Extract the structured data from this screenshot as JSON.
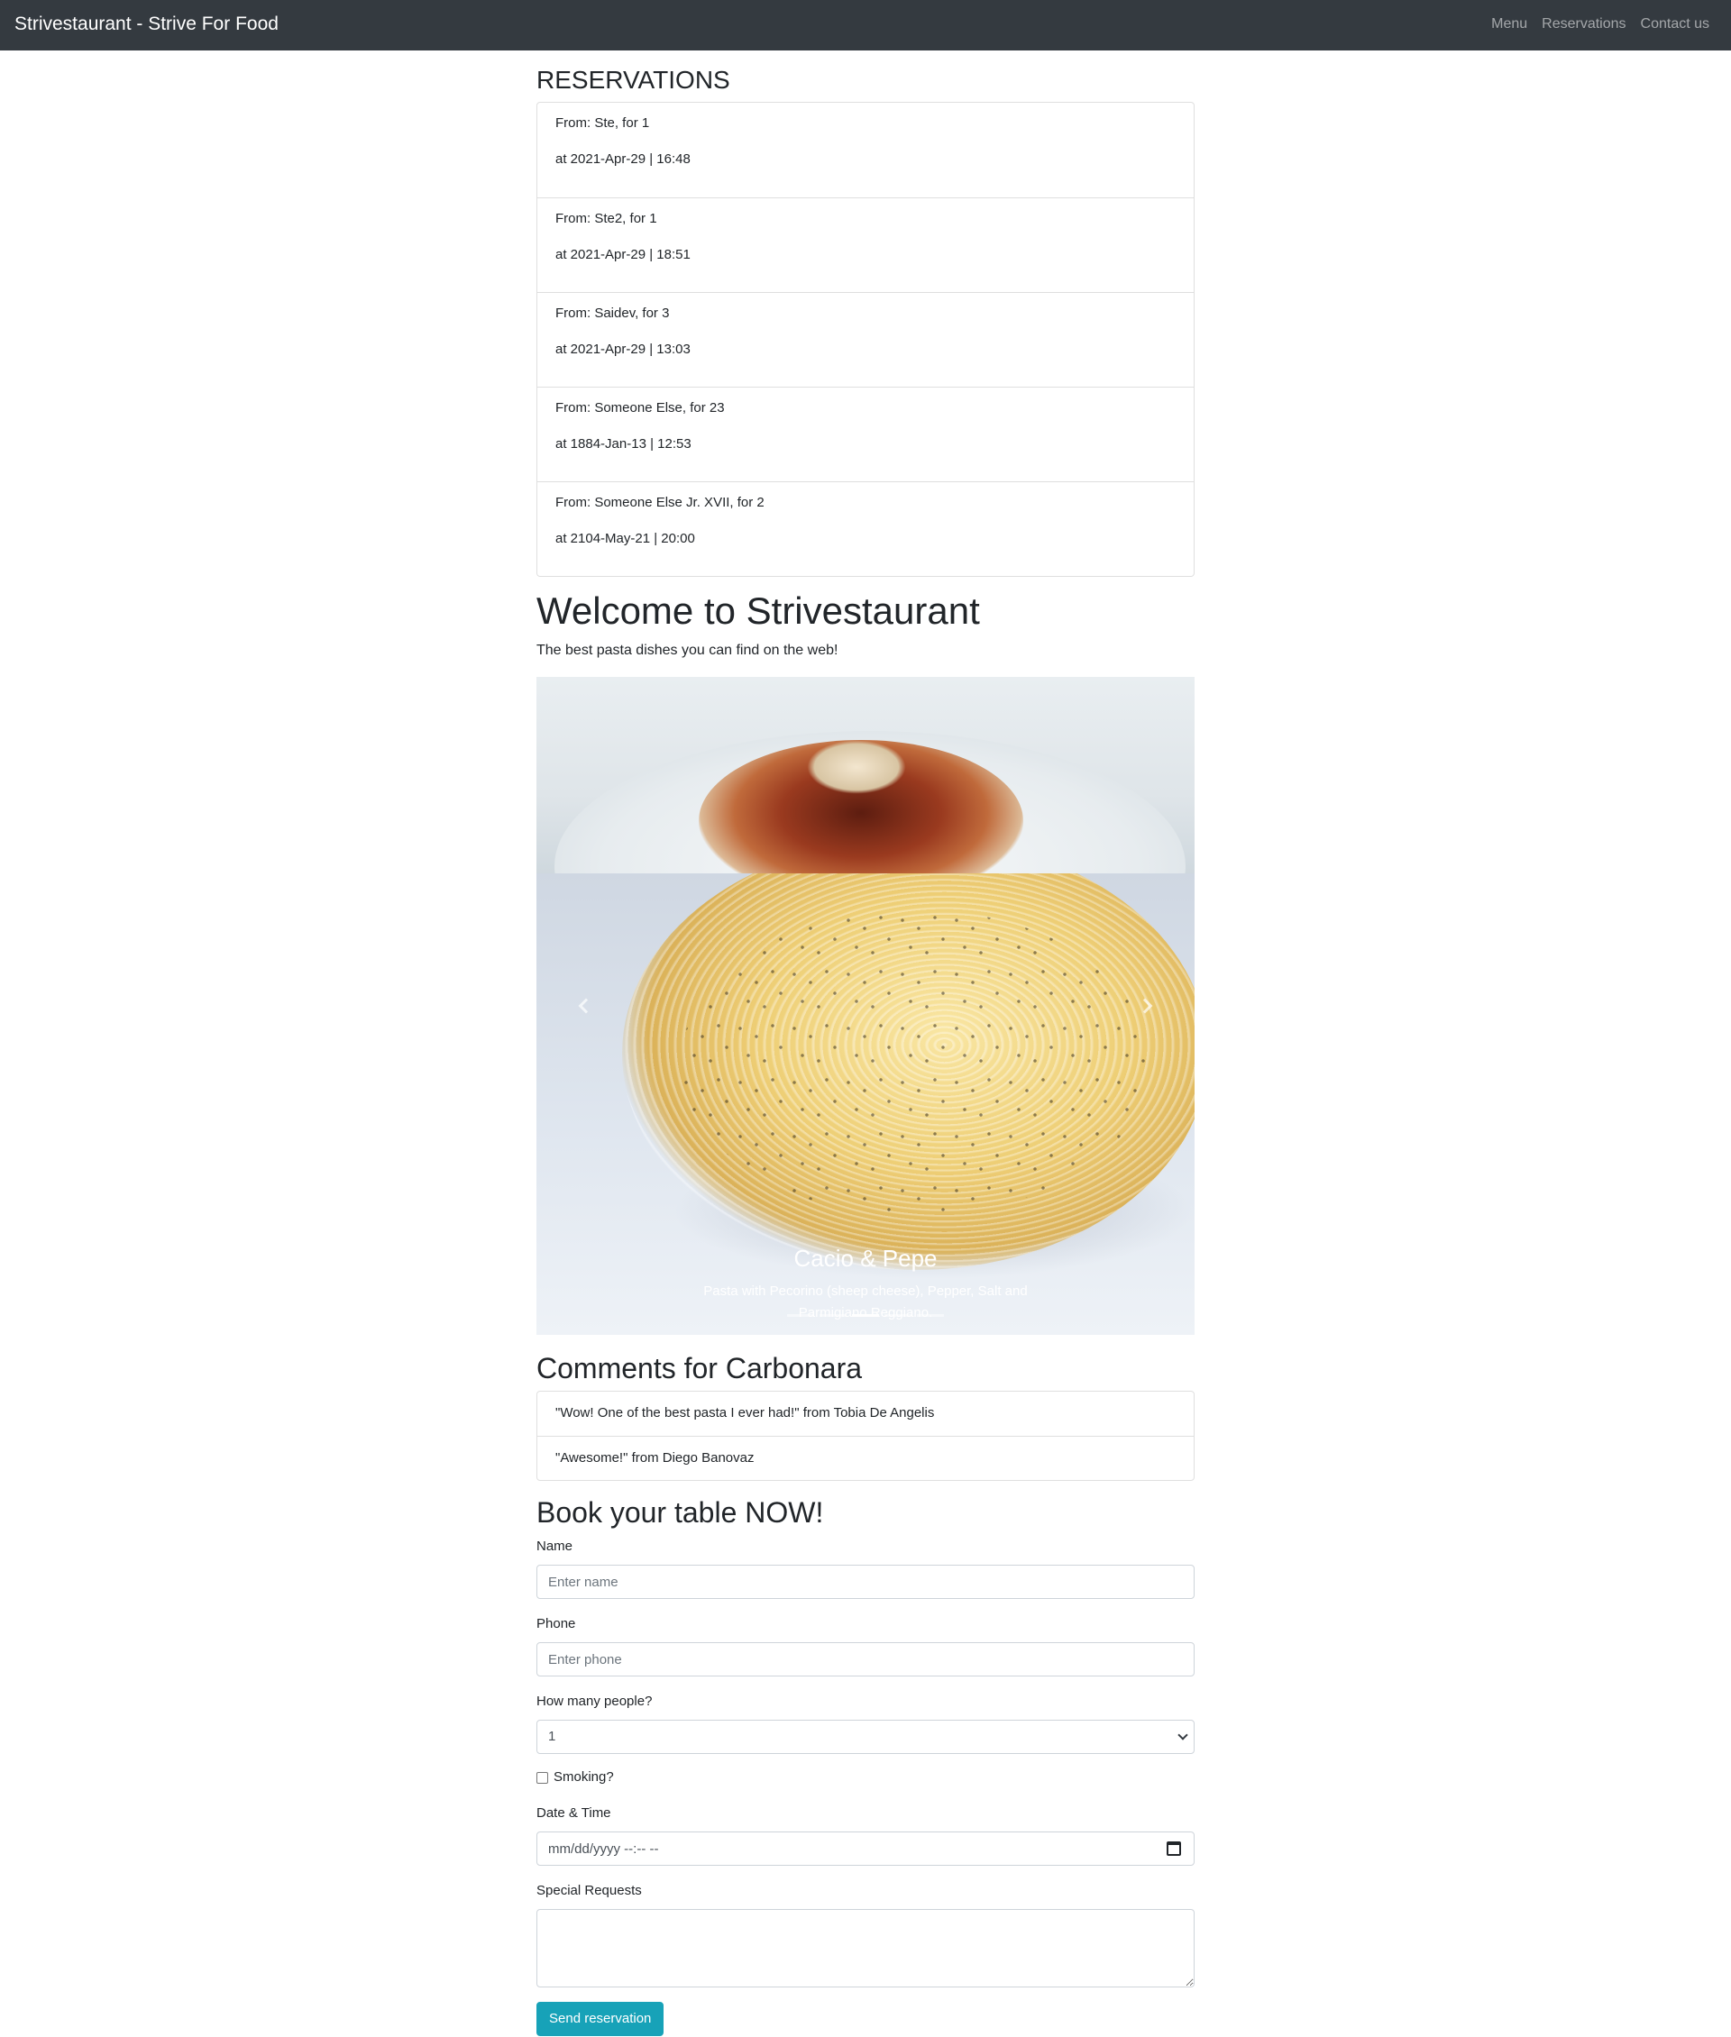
{
  "navbar": {
    "brand": "Strivestaurant - Strive For Food",
    "links": [
      "Menu",
      "Reservations",
      "Contact us"
    ]
  },
  "reservations": {
    "heading": "RESERVATIONS",
    "items": [
      {
        "from": "From: Ste, for 1",
        "at": "at 2021-Apr-29 | 16:48"
      },
      {
        "from": "From: Ste2, for 1",
        "at": "at 2021-Apr-29 | 18:51"
      },
      {
        "from": "From: Saidev, for 3",
        "at": "at 2021-Apr-29 | 13:03"
      },
      {
        "from": "From: Someone Else, for 23",
        "at": "at 1884-Jan-13 | 12:53"
      },
      {
        "from": "From: Someone Else Jr. XVII, for 2",
        "at": "at 2104-May-21 | 20:00"
      }
    ]
  },
  "hero": {
    "title": "Welcome to Strivestaurant",
    "tagline": "The best pasta dishes you can find on the web!"
  },
  "carousel": {
    "caption_title": "Cacio & Pepe",
    "caption_text": "Pasta with Pecorino (sheep cheese), Pepper, Salt and Parmigiano Reggiano.",
    "indicator_count": 5,
    "active_index": 2,
    "prev_icon": "chevron-left-icon",
    "next_icon": "chevron-right-icon"
  },
  "comments": {
    "heading": "Comments for Carbonara",
    "items": [
      "\"Wow! One of the best pasta I ever had!\" from Tobia De Angelis",
      "\"Awesome!\" from Diego Banovaz"
    ]
  },
  "form": {
    "heading": "Book your table NOW!",
    "name_label": "Name",
    "name_placeholder": "Enter name",
    "phone_label": "Phone",
    "phone_placeholder": "Enter phone",
    "people_label": "How many people?",
    "people_value": "1",
    "smoking_label": "Smoking?",
    "datetime_label": "Date & Time",
    "datetime_placeholder": "mm/dd/yyyy --:-- --",
    "requests_label": "Special Requests",
    "submit_label": "Send reservation"
  },
  "colors": {
    "navbar_bg": "#343a40",
    "button_bg": "#17a2b8"
  }
}
